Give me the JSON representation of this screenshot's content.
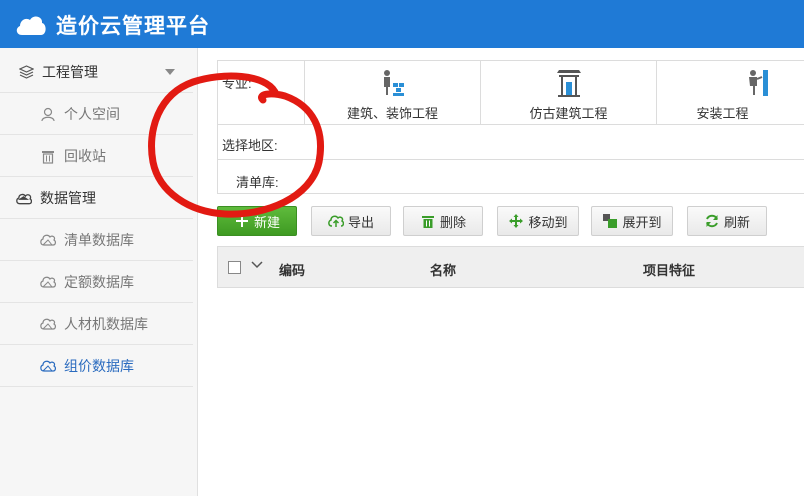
{
  "app": {
    "title": "造价云管理平台"
  },
  "sidebar": {
    "group1": {
      "label": "工程管理"
    },
    "group1_items": [
      {
        "label": "个人空间"
      },
      {
        "label": "回收站"
      }
    ],
    "group2": {
      "label": "数据管理"
    },
    "group2_items": [
      {
        "label": "清单数据库"
      },
      {
        "label": "定额数据库"
      },
      {
        "label": "人材机数据库"
      },
      {
        "label": "组价数据库"
      }
    ]
  },
  "filters": {
    "category_label": "专业:",
    "categories": [
      {
        "label": "建筑、装饰工程"
      },
      {
        "label": "仿古建筑工程"
      },
      {
        "label": "安装工程"
      }
    ],
    "region_label": "选择地区:",
    "library_label": "清单库:"
  },
  "toolbar": {
    "new_label": "新建",
    "export_label": "导出",
    "delete_label": "删除",
    "move_label": "移动到",
    "expand_label": "展开到",
    "refresh_label": "刷新"
  },
  "table": {
    "columns": [
      "编码",
      "名称",
      "项目特征"
    ]
  },
  "colors": {
    "header": "#1f7ad6",
    "accent": "#2a6bbf",
    "new_button": "#4aa52c",
    "annotation": "#e21a12"
  }
}
